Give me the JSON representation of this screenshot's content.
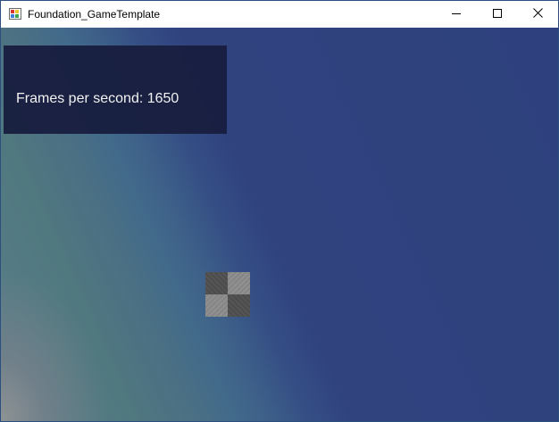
{
  "window": {
    "title": "Foundation_GameTemplate"
  },
  "titlebar": {
    "icons": [
      "app-icon",
      "minimize-icon",
      "maximize-icon",
      "close-icon"
    ]
  },
  "hud": {
    "fps_label": "Frames per second: ",
    "fps_value": "1650"
  },
  "scene": {
    "sprite": "checkerboard-tile",
    "colors": {
      "background_blue": "#2e417e",
      "background_teal": "#5a7f8a",
      "panel": "#181e40",
      "checker_dark": "#505050",
      "checker_light": "#8c8c8c"
    }
  }
}
